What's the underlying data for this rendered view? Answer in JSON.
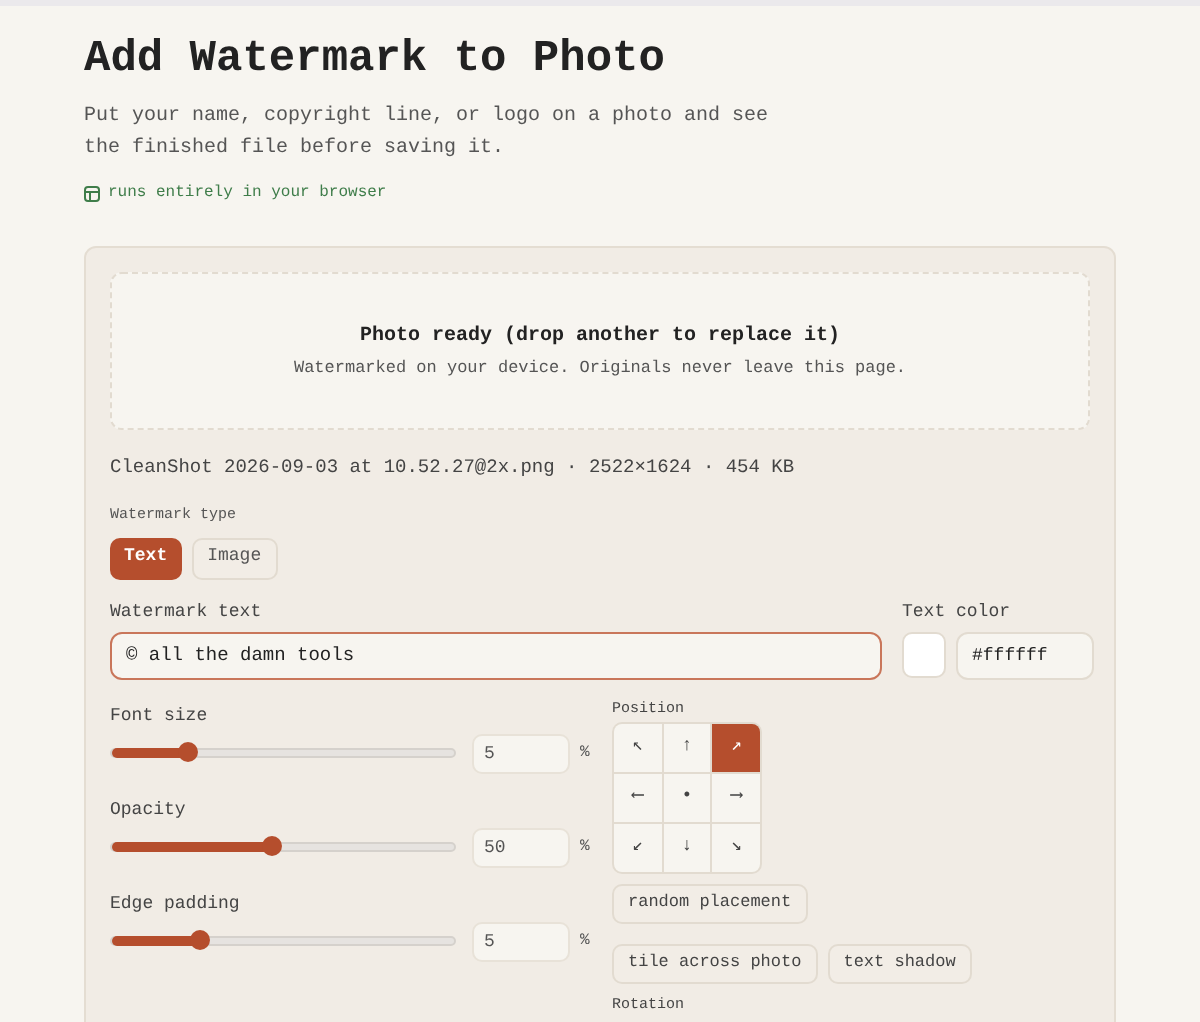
{
  "title": "Add Watermark to Photo",
  "subtitle": "Put your name, copyright line, or logo on a photo and see the finished file before saving it.",
  "badge": "runs entirely in your browser",
  "dropzone": {
    "title": "Photo ready (drop another to replace it)",
    "note": "Watermarked on your device. Originals never leave this page."
  },
  "file_info": "CleanShot 2026-09-03 at 10.52.27@2x.png · 2522×1624 · 454 KB",
  "type_label": "Watermark type",
  "type_options": [
    {
      "label": "Text",
      "selected": true
    },
    {
      "label": "Image",
      "selected": false
    }
  ],
  "text_field": {
    "label": "Watermark text",
    "value": "© all the damn tools"
  },
  "color_field": {
    "label": "Text color",
    "value": "#ffffff",
    "color": "#ffffff"
  },
  "sliders": [
    {
      "label": "Font size",
      "level": 0.22,
      "value": "5",
      "unit": "%"
    },
    {
      "label": "Opacity",
      "level": 0.47,
      "value": "50",
      "unit": "%"
    },
    {
      "label": "Edge padding",
      "level": 0.26,
      "value": "5",
      "unit": "%"
    }
  ],
  "position": {
    "label": "Position",
    "cells": [
      {
        "glyph": "↖",
        "selected": false
      },
      {
        "glyph": "↑",
        "selected": false
      },
      {
        "glyph": "↗",
        "selected": true
      },
      {
        "glyph": "⟵",
        "selected": false
      },
      {
        "glyph": "•",
        "selected": false
      },
      {
        "glyph": "⟶",
        "selected": false
      },
      {
        "glyph": "↙",
        "selected": false
      },
      {
        "glyph": "↓",
        "selected": false
      },
      {
        "glyph": "↘",
        "selected": false
      }
    ]
  },
  "random_button": "random placement",
  "toggles": [
    {
      "label": "tile across photo",
      "on": false
    },
    {
      "label": "text shadow",
      "on": false
    }
  ],
  "rotation_label": "Rotation"
}
